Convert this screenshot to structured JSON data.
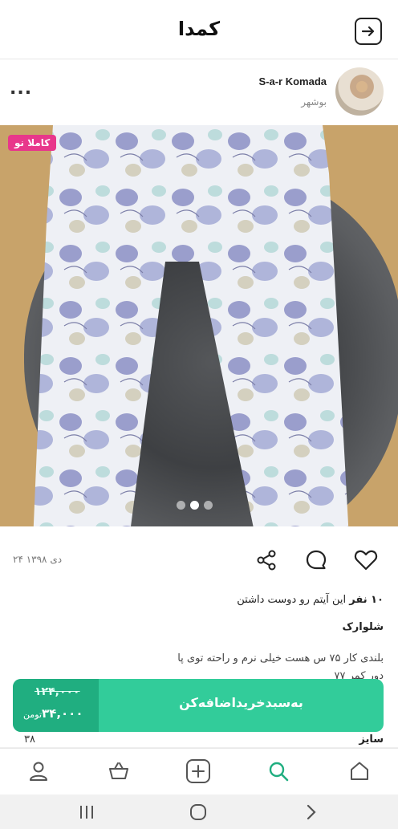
{
  "app": {
    "title": "کمدا"
  },
  "seller": {
    "name": "S-a-r Komada",
    "city": "بوشهر",
    "more_label": "..."
  },
  "product": {
    "badge": "کاملا نو",
    "image_count": 3,
    "active_image": 2,
    "date": "۲۴ دی ۱۳۹۸",
    "likes_count": "۱۰ نفر",
    "likes_text": "این آیتم رو دوست داشتن",
    "type": "شلوارک",
    "description_line1": "بلندی کار ۷۵ س هست خیلی نرم و راحته توی پا",
    "description_line2": "دور کمر ۷۷",
    "size_label": "سایز",
    "size_value": "۳۸"
  },
  "buy": {
    "old_price": "۱۲۴,۰۰۰",
    "new_price": "۳۴,۰۰۰",
    "currency": "تومن",
    "cta": "به‌سبدخرید‌اضافه‌کن"
  },
  "colors": {
    "accent": "#32cc9a",
    "accent_dark": "#20ae80",
    "badge": "#e8378b"
  },
  "icons": {
    "back": "arrow-right-box-icon",
    "like": "heart-icon",
    "comment": "chat-bubble-icon",
    "share": "share-icon",
    "tabs": [
      "home-icon",
      "search-icon",
      "add-icon",
      "basket-icon",
      "profile-icon"
    ],
    "system": [
      "recents-icon",
      "home-circle-icon",
      "back-chevron-icon"
    ]
  }
}
